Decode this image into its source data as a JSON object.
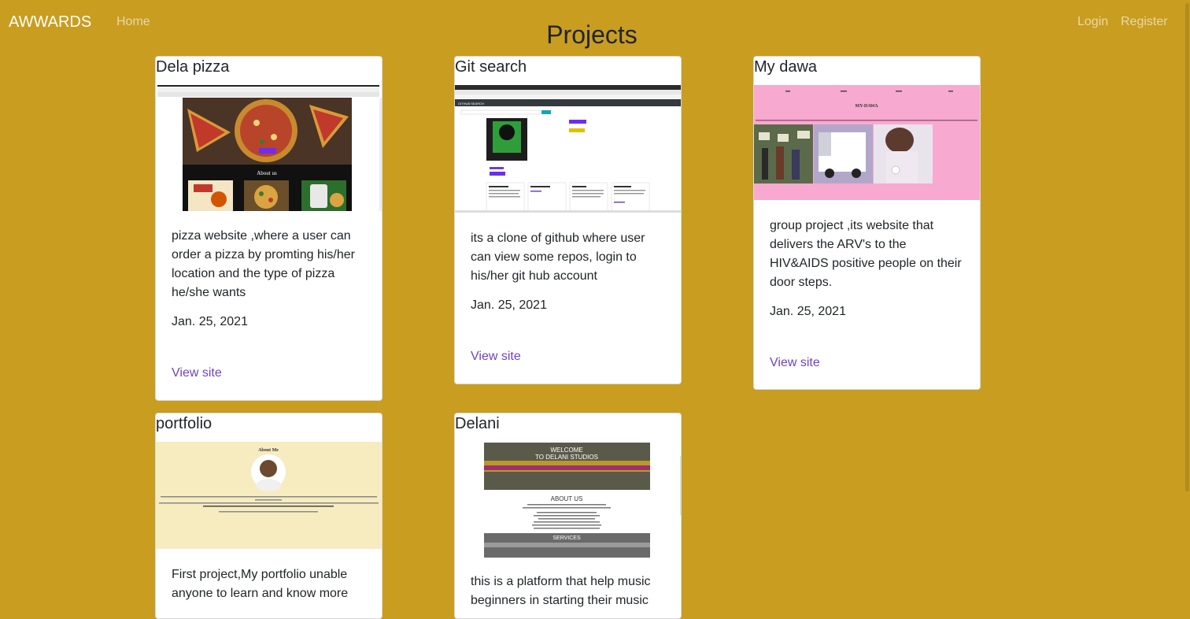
{
  "nav": {
    "brand": "AWWARDS",
    "home": "Home",
    "login": "Login",
    "register": "Register"
  },
  "page_title": "Projects",
  "projects": [
    {
      "title": "Dela pizza",
      "description": "pizza website ,where a user can order a pizza by promting his/her location and the type of pizza he/she wants",
      "date": "Jan. 25, 2021",
      "link_label": "View site"
    },
    {
      "title": "Git search",
      "description": "its a clone of github where user can view some repos, login to his/her git hub account",
      "date": "Jan. 25, 2021",
      "link_label": "View site"
    },
    {
      "title": "My dawa",
      "description": "group project ,its website that delivers the ARV's to the HIV&AIDS positive people on their door steps.",
      "date": "Jan. 25, 2021",
      "link_label": "View site"
    },
    {
      "title": "portfolio",
      "description": "First project,My portfolio unable anyone to learn and know more",
      "date": "",
      "link_label": ""
    },
    {
      "title": "Delani",
      "description": "this is a platform that help music beginners in starting their music",
      "date": "",
      "link_label": ""
    }
  ],
  "thumbnails": {
    "pizza": {
      "about": "About us"
    },
    "git": {
      "header": "GITHUB SEARCH"
    },
    "dawa": {
      "heading": "MY-DAWA"
    },
    "portfolio": {
      "heading": "About Me"
    },
    "delani": {
      "welcome": "WELCOME",
      "studio": "TO DELANI STUDIOS",
      "about": "ABOUT US",
      "services": "SERVICES"
    }
  }
}
